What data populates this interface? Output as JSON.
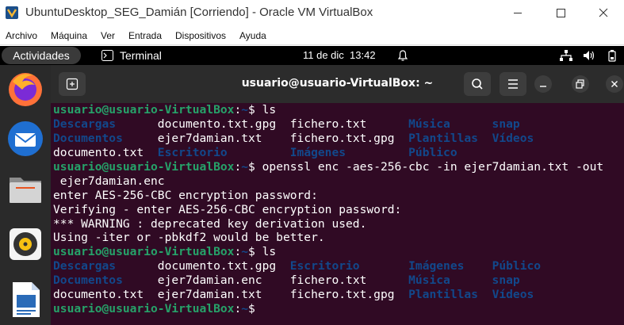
{
  "window": {
    "title": "UbuntuDesktop_SEG_Damián [Corriendo] - Oracle VM VirtualBox"
  },
  "vbox_menu": [
    "Archivo",
    "Máquina",
    "Ver",
    "Entrada",
    "Dispositivos",
    "Ayuda"
  ],
  "topbar": {
    "activities": "Actividades",
    "app_name": "Terminal",
    "clock": "11 de dic  13:42"
  },
  "dock": {
    "items": [
      "firefox-icon",
      "thunderbird-icon",
      "files-icon",
      "rhythmbox-icon",
      "libreoffice-writer-icon"
    ]
  },
  "terminal": {
    "title": "usuario@usuario-VirtualBox: ~",
    "lines": [
      [
        {
          "t": "usuario@usuario-VirtualBox",
          "c": "prompt"
        },
        {
          "t": ":",
          "c": ""
        },
        {
          "t": "~",
          "c": "cwd"
        },
        {
          "t": "$ ls",
          "c": ""
        }
      ],
      [
        {
          "t": "Descargas",
          "c": "dir"
        },
        {
          "t": "      documento.txt.gpg  fichero.txt      ",
          "c": ""
        },
        {
          "t": "Música",
          "c": "dir"
        },
        {
          "t": "      ",
          "c": ""
        },
        {
          "t": "snap",
          "c": "dir"
        }
      ],
      [
        {
          "t": "Documentos",
          "c": "dir"
        },
        {
          "t": "     ejer7damian.txt    fichero.txt.gpg  ",
          "c": ""
        },
        {
          "t": "Plantillas",
          "c": "dir"
        },
        {
          "t": "  ",
          "c": ""
        },
        {
          "t": "Vídeos",
          "c": "dir"
        }
      ],
      [
        {
          "t": "documento.txt  ",
          "c": ""
        },
        {
          "t": "Escritorio",
          "c": "dir"
        },
        {
          "t": "         ",
          "c": ""
        },
        {
          "t": "Imágenes",
          "c": "dir"
        },
        {
          "t": "         ",
          "c": ""
        },
        {
          "t": "Público",
          "c": "dir"
        }
      ],
      [
        {
          "t": "usuario@usuario-VirtualBox",
          "c": "prompt"
        },
        {
          "t": ":",
          "c": ""
        },
        {
          "t": "~",
          "c": "cwd"
        },
        {
          "t": "$ openssl enc -aes-256-cbc -in ejer7damian.txt -out",
          "c": ""
        }
      ],
      [
        {
          "t": " ejer7damian.enc",
          "c": ""
        }
      ],
      [
        {
          "t": "enter AES-256-CBC encryption password:",
          "c": ""
        }
      ],
      [
        {
          "t": "Verifying - enter AES-256-CBC encryption password:",
          "c": ""
        }
      ],
      [
        {
          "t": "*** WARNING : deprecated key derivation used.",
          "c": ""
        }
      ],
      [
        {
          "t": "Using -iter or -pbkdf2 would be better.",
          "c": ""
        }
      ],
      [
        {
          "t": "usuario@usuario-VirtualBox",
          "c": "prompt"
        },
        {
          "t": ":",
          "c": ""
        },
        {
          "t": "~",
          "c": "cwd"
        },
        {
          "t": "$ ls",
          "c": ""
        }
      ],
      [
        {
          "t": "Descargas",
          "c": "dir"
        },
        {
          "t": "      documento.txt.gpg  ",
          "c": ""
        },
        {
          "t": "Escritorio",
          "c": "dir"
        },
        {
          "t": "       ",
          "c": ""
        },
        {
          "t": "Imágenes",
          "c": "dir"
        },
        {
          "t": "    ",
          "c": ""
        },
        {
          "t": "Público",
          "c": "dir"
        }
      ],
      [
        {
          "t": "Documentos",
          "c": "dir"
        },
        {
          "t": "     ejer7damian.enc    fichero.txt      ",
          "c": ""
        },
        {
          "t": "Música",
          "c": "dir"
        },
        {
          "t": "      ",
          "c": ""
        },
        {
          "t": "snap",
          "c": "dir"
        }
      ],
      [
        {
          "t": "documento.txt  ejer7damian.txt    fichero.txt.gpg  ",
          "c": ""
        },
        {
          "t": "Plantillas",
          "c": "dir"
        },
        {
          "t": "  ",
          "c": ""
        },
        {
          "t": "Vídeos",
          "c": "dir"
        }
      ],
      [
        {
          "t": "usuario@usuario-VirtualBox",
          "c": "prompt"
        },
        {
          "t": ":",
          "c": ""
        },
        {
          "t": "~",
          "c": "cwd"
        },
        {
          "t": "$ ",
          "c": ""
        }
      ]
    ]
  },
  "colors": {
    "terminal_bg": "#300a24",
    "prompt": "#26a269",
    "directory": "#12488b",
    "accent": "#e95420"
  }
}
